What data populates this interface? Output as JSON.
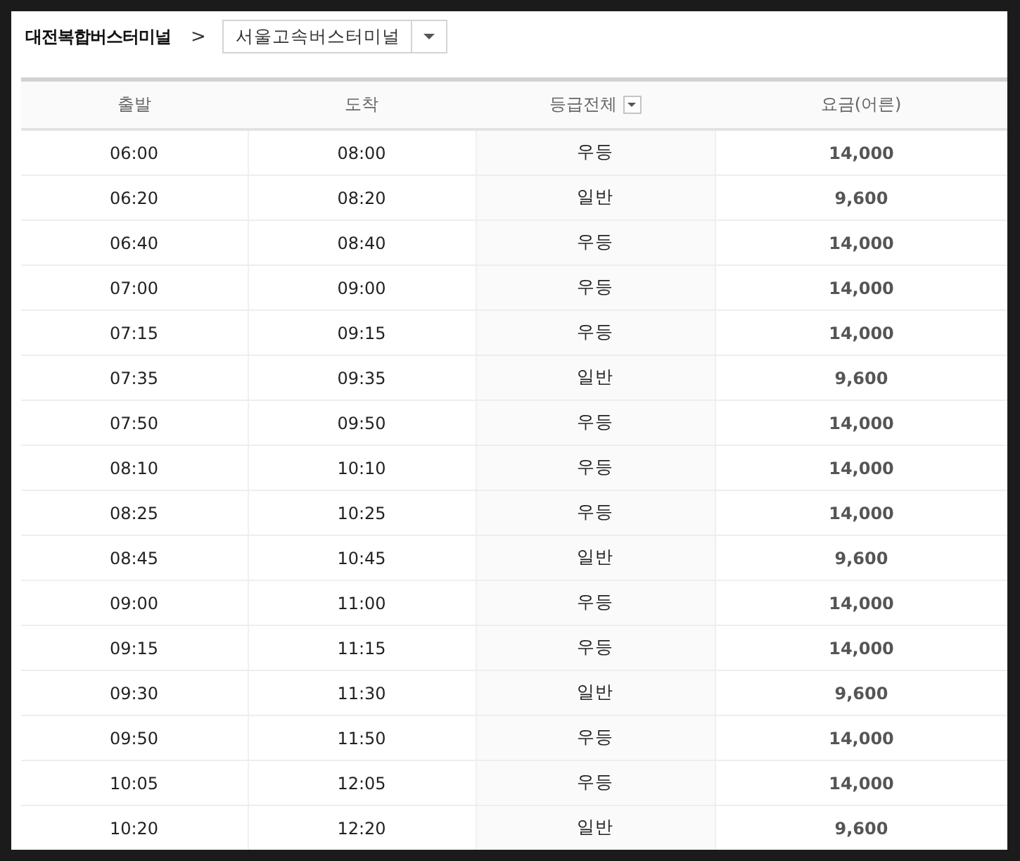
{
  "route": {
    "origin": "대전복합버스터미널",
    "separator": ">",
    "destination": "서울고속버스터미널"
  },
  "table": {
    "columns": [
      {
        "label": "출발",
        "kind": "plain"
      },
      {
        "label": "도착",
        "kind": "plain"
      },
      {
        "label": "등급전체",
        "kind": "filter"
      },
      {
        "label": "요금(어른)",
        "kind": "plain"
      }
    ],
    "rows": [
      [
        "06:00",
        "08:00",
        "우등",
        "14,000"
      ],
      [
        "06:20",
        "08:20",
        "일반",
        "9,600"
      ],
      [
        "06:40",
        "08:40",
        "우등",
        "14,000"
      ],
      [
        "07:00",
        "09:00",
        "우등",
        "14,000"
      ],
      [
        "07:15",
        "09:15",
        "우등",
        "14,000"
      ],
      [
        "07:35",
        "09:35",
        "일반",
        "9,600"
      ],
      [
        "07:50",
        "09:50",
        "우등",
        "14,000"
      ],
      [
        "08:10",
        "10:10",
        "우등",
        "14,000"
      ],
      [
        "08:25",
        "10:25",
        "우등",
        "14,000"
      ],
      [
        "08:45",
        "10:45",
        "일반",
        "9,600"
      ],
      [
        "09:00",
        "11:00",
        "우등",
        "14,000"
      ],
      [
        "09:15",
        "11:15",
        "우등",
        "14,000"
      ],
      [
        "09:30",
        "11:30",
        "일반",
        "9,600"
      ],
      [
        "09:50",
        "11:50",
        "우등",
        "14,000"
      ],
      [
        "10:05",
        "12:05",
        "우등",
        "14,000"
      ],
      [
        "10:20",
        "12:20",
        "일반",
        "9,600"
      ]
    ]
  }
}
